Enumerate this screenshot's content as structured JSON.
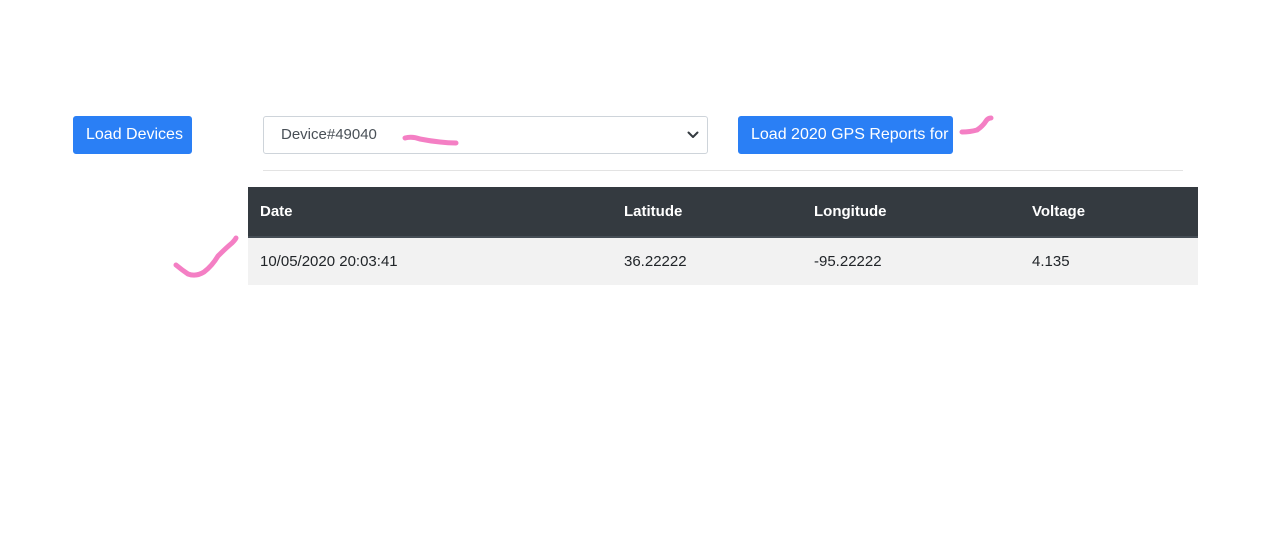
{
  "toolbar": {
    "load_devices_label": "Load Devices",
    "device_select_value": "Device#49040",
    "load_reports_label": "Load 2020 GPS Reports for"
  },
  "table": {
    "headers": [
      "Date",
      "Latitude",
      "Longitude",
      "Voltage"
    ],
    "rows": [
      [
        "10/05/2020 20:03:41",
        "36.22222",
        "-95.22222",
        "4.135"
      ]
    ]
  },
  "colors": {
    "primary": "#2a7ff5",
    "header_bg": "#343a40",
    "row_bg": "#f2f2f2",
    "annotation": "#f47fc4"
  }
}
